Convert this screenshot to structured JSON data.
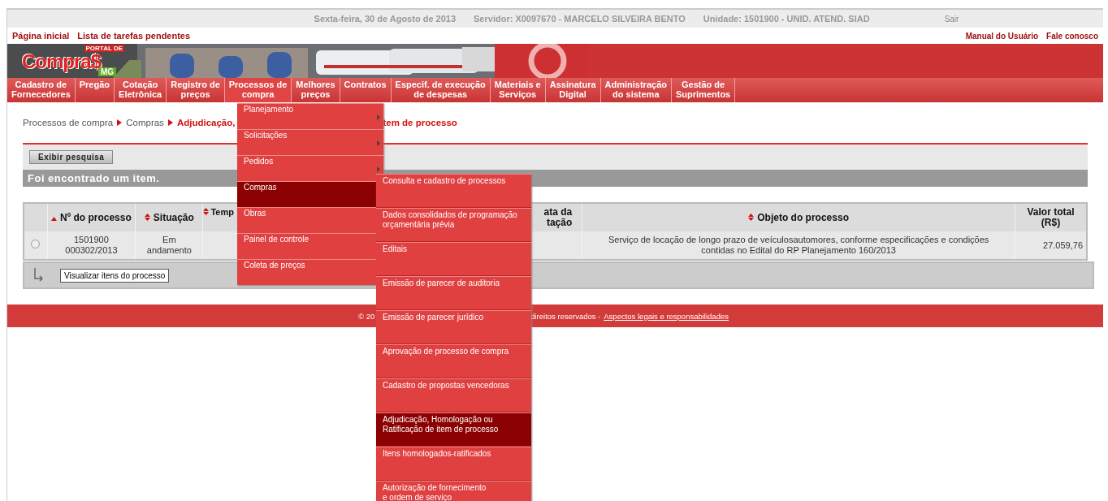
{
  "top_bar": {
    "date": "Sexta-feira, 30 de Agosto de 2013",
    "server": "Servidor: X0097670 - MARCELO SILVEIRA BENTO",
    "unit": "Unidade: 1501900 - UNID. ATEND. SIAD",
    "logout": "Sair"
  },
  "links_left": [
    "Página inicial",
    "Lista de tarefas pendentes"
  ],
  "links_right": [
    "Manual do Usuário",
    "Fale conosco"
  ],
  "logo": {
    "small": "PORTAL DE",
    "main": "Compra$",
    "sub": "MG"
  },
  "nav": [
    {
      "label": "Cadastro de\nFornecedores",
      "selected": false
    },
    {
      "label": "Pregão",
      "selected": false
    },
    {
      "label": "Cotação\nEletrônica",
      "selected": false
    },
    {
      "label": "Registro de\npreços",
      "selected": false
    },
    {
      "label": "Processos de\ncompra",
      "selected": true
    },
    {
      "label": "Melhores\npreços",
      "selected": false
    },
    {
      "label": "Contratos",
      "selected": false
    },
    {
      "label": "Especif. de execução\nde despesas",
      "selected": false
    },
    {
      "label": "Materiais e\nServiços",
      "selected": false
    },
    {
      "label": "Assinatura\nDigital",
      "selected": false
    },
    {
      "label": "Administração\ndo sistema",
      "selected": false
    },
    {
      "label": "Gestão de\nSuprimentos",
      "selected": false
    }
  ],
  "breadcrumb": {
    "items": [
      "Processos de compra",
      "Compras"
    ],
    "current_visible": [
      "Adjudicação,",
      "tem de processo"
    ]
  },
  "search_button": "Exibir pesquisa",
  "result_bar": "Foi encontrado um item.",
  "table": {
    "columns": [
      {
        "label": "Nº do processo",
        "kind": "sorted"
      },
      {
        "label": "Situação",
        "kind": "sortable"
      },
      {
        "label": "Temp",
        "kind": "sortable"
      },
      {
        "label": "ata da\ntação",
        "kind": "plain"
      },
      {
        "label": "Objeto do processo",
        "kind": "sortable"
      },
      {
        "label": "Valor total\n(R$)",
        "kind": "plain"
      }
    ],
    "rows": [
      {
        "selected": false,
        "cells": [
          "1501900\n000302/2013",
          "Em\nandamento",
          "",
          "",
          "Serviço de locação de longo prazo de veículosautomores, conforme especificações e condições contidas no Edital do RP Planejamento 160/2013",
          "27.059,76"
        ]
      }
    ]
  },
  "action_button": "Visualizar itens do processo",
  "footer": {
    "left": "© 20",
    "right": "direitos reservados -",
    "link": "Aspectos legais e responsabilidades"
  },
  "menu": [
    {
      "label": "Planejamento",
      "selected": false,
      "submenu": true
    },
    {
      "label": "Solicitações",
      "selected": false,
      "submenu": true
    },
    {
      "label": "Pedidos",
      "selected": false,
      "submenu": true
    },
    {
      "label": "Compras",
      "selected": true,
      "submenu": false
    },
    {
      "label": "Obras",
      "selected": false,
      "submenu": false
    },
    {
      "label": "Painel de controle",
      "selected": false,
      "submenu": false
    },
    {
      "label": "Coleta de preços",
      "selected": false,
      "submenu": false
    }
  ],
  "submenu": [
    {
      "label": "Consulta e cadastro de processos",
      "selected": false
    },
    {
      "label": "Dados consolidados de programação orçamentária prévia",
      "selected": false
    },
    {
      "label": "Editais",
      "selected": false
    },
    {
      "label": "Emissão de parecer de auditoria",
      "selected": false
    },
    {
      "label": "Emissão de parecer jurídico",
      "selected": false
    },
    {
      "label": "Aprovação de processo de compra",
      "selected": false
    },
    {
      "label": "Cadastro de propostas vencedoras",
      "selected": false
    },
    {
      "label": "Adjudicação, Homologação ou Ratificação de item de processo",
      "selected": true
    },
    {
      "label": "Itens homologados-ratificados",
      "selected": false
    },
    {
      "label": "Autorização de fornecimento\ne ordem de serviço",
      "selected": false
    }
  ]
}
